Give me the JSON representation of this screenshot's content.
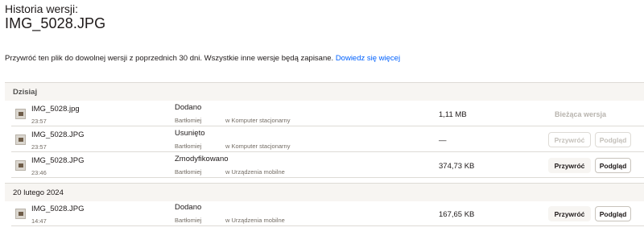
{
  "header": {
    "label": "Historia wersji:",
    "filename": "IMG_5028.JPG"
  },
  "description": {
    "text": "Przywróć ten plik do dowolnej wersji z poprzednich 30 dni. Wszystkie inne wersje będą zapisane.",
    "link": "Dowiedz się więcej"
  },
  "sections": [
    {
      "label": "Dzisiaj",
      "rows": [
        {
          "name": "IMG_5028.jpg",
          "time": "23:57",
          "action": "Dodano",
          "author": "Bartłomiej",
          "location": "w Komputer stacjonarny",
          "size": "1,11 MB",
          "status": "Bieżąca wersja"
        },
        {
          "name": "IMG_5028.JPG",
          "time": "23:57",
          "action": "Usunięto",
          "author": "Bartłomiej",
          "location": "w Komputer stacjonarny",
          "size": "—",
          "restore": "Przywróć",
          "preview": "Podgląd"
        },
        {
          "name": "IMG_5028.JPG",
          "time": "23:46",
          "action": "Zmodyfikowano",
          "author": "Bartłomiej",
          "location": "w Urządzenia mobilne",
          "size": "374,73 KB",
          "restore": "Przywróć",
          "preview": "Podgląd"
        }
      ]
    },
    {
      "label": "20 lutego 2024",
      "rows": [
        {
          "name": "IMG_5028.JPG",
          "time": "14:47",
          "action": "Dodano",
          "author": "Bartłomiej",
          "location": "w Urządzenia mobilne",
          "size": "167,65 KB",
          "restore": "Przywróć",
          "preview": "Podgląd"
        }
      ]
    }
  ]
}
